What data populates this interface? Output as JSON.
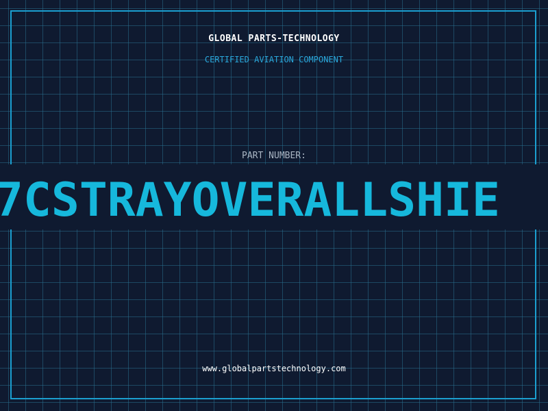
{
  "header": {
    "brand": "GLOBAL PARTS-TECHNOLOGY",
    "subtitle": "CERTIFIED AVIATION COMPONENT"
  },
  "part": {
    "label": "PART NUMBER:",
    "number": "7CSTRAYOVERALLSHIE"
  },
  "footer": {
    "url": "www.globalpartstechnology.com"
  },
  "colors": {
    "background": "#0f1a30",
    "grid": "#286e8c",
    "frame": "#1b9fd0",
    "accent": "#16b8dc",
    "label": "#aab6c4",
    "text": "#ffffff"
  }
}
